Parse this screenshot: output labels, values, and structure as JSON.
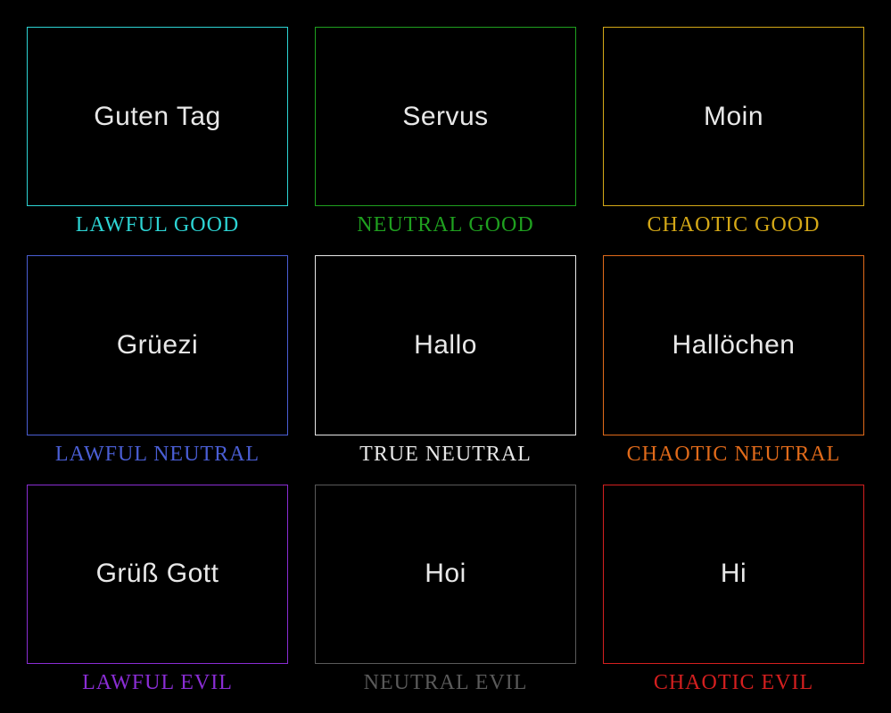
{
  "cells": [
    {
      "content": "Guten Tag",
      "label": "LAWFUL GOOD",
      "color": "#2dd4d4"
    },
    {
      "content": "Servus",
      "label": "NEUTRAL GOOD",
      "color": "#1fa01f"
    },
    {
      "content": "Moin",
      "label": "CHAOTIC GOOD",
      "color": "#d4a817"
    },
    {
      "content": "Grüezi",
      "label": "LAWFUL NEUTRAL",
      "color": "#4a5ed4"
    },
    {
      "content": "Hallo",
      "label": "TRUE NEUTRAL",
      "color": "#e8e8e8"
    },
    {
      "content": "Hallöchen",
      "label": "CHAOTIC NEUTRAL",
      "color": "#e06a1a"
    },
    {
      "content": "Grüß Gott",
      "label": "LAWFUL EVIL",
      "color": "#8a2dd4"
    },
    {
      "content": "Hoi",
      "label": "NEUTRAL EVIL",
      "color": "#5a5a5a"
    },
    {
      "content": "Hi",
      "label": "CHAOTIC EVIL",
      "color": "#d41f1f"
    }
  ]
}
